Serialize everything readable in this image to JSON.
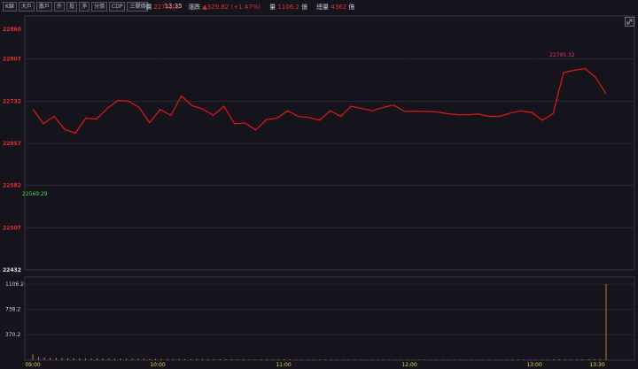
{
  "toolbar": {
    "buttons": [
      "K線",
      "大戶",
      "散戶",
      "外",
      "投",
      "淨",
      "分價",
      "CDP",
      "三關價"
    ],
    "time": "13:35"
  },
  "quote": {
    "price_label": "價",
    "price": "22761.6",
    "change_label": "漲跌",
    "change": "▲329.82 (+1.47%)",
    "volume_label": "量",
    "volume": "1106.2",
    "volume_unit": "億",
    "total_label": "總量",
    "total": "4362",
    "total_unit": "億"
  },
  "colors": {
    "price_line": "#e01818",
    "volume_bar": "#d9863a",
    "grid": "#34323f",
    "axis_label": "#e03030",
    "time_label": "#e6d24a",
    "ref_label": "#4fd24f",
    "max_label": "#e0306a"
  },
  "chart_data": [
    {
      "type": "line",
      "title": "",
      "ylim": [
        22432,
        22860
      ],
      "y_ticks": [
        22860,
        22807,
        22732,
        22657,
        22582,
        22507,
        22432
      ],
      "x_ticks": [
        "09:00",
        "10:00",
        "11:00",
        "12:00",
        "13:00",
        "13:30"
      ],
      "reference_label": "22569.29",
      "max_label": "22795.32",
      "x": [
        "09:00",
        "09:05",
        "09:10",
        "09:15",
        "09:20",
        "09:25",
        "09:30",
        "09:35",
        "09:40",
        "09:45",
        "09:50",
        "09:55",
        "10:00",
        "10:05",
        "10:10",
        "10:15",
        "10:20",
        "10:25",
        "10:30",
        "10:35",
        "10:40",
        "10:45",
        "10:50",
        "10:55",
        "11:00",
        "11:05",
        "11:10",
        "11:15",
        "11:20",
        "11:25",
        "11:30",
        "11:35",
        "11:40",
        "11:45",
        "11:50",
        "11:55",
        "12:00",
        "12:05",
        "12:10",
        "12:15",
        "12:20",
        "12:25",
        "12:30",
        "12:35",
        "12:40",
        "12:45",
        "12:50",
        "12:55",
        "13:00",
        "13:05",
        "13:10",
        "13:15",
        "13:20",
        "13:25",
        "13:30"
      ],
      "values": [
        22718,
        22695,
        22702,
        22685,
        22672,
        22705,
        22697,
        22722,
        22730,
        22735,
        22718,
        22697,
        22714,
        22710,
        22738,
        22727,
        22715,
        22710,
        22720,
        22695,
        22690,
        22684,
        22696,
        22705,
        22712,
        22708,
        22700,
        22701,
        22712,
        22708,
        22720,
        22722,
        22712,
        22724,
        22722,
        22717,
        22711,
        22717,
        22710,
        22713,
        22705,
        22711,
        22706,
        22708,
        22702,
        22714,
        22712,
        22715,
        22695,
        22713,
        22780,
        22790,
        22787,
        22778,
        22745
      ]
    },
    {
      "type": "bar",
      "title": "",
      "ylim": [
        0,
        1106.2
      ],
      "y_ticks": [
        1106.2,
        738.2,
        370.2
      ],
      "values": [
        85,
        48,
        40,
        36,
        34,
        32,
        30,
        28,
        27,
        26,
        25,
        24,
        23,
        22,
        22,
        21,
        20,
        20,
        19,
        19,
        18,
        18,
        17,
        17,
        16,
        16,
        16,
        15,
        15,
        15,
        14,
        14,
        14,
        13,
        13,
        13,
        12,
        12,
        12,
        12,
        11,
        11,
        11,
        11,
        11,
        10,
        10,
        10,
        10,
        10,
        9,
        9,
        9,
        9,
        9,
        9,
        8,
        8,
        8,
        8,
        8,
        8,
        8,
        8,
        8,
        8,
        8,
        8,
        8,
        8,
        8,
        8,
        8,
        8,
        8,
        8,
        8,
        8,
        8,
        8,
        8,
        9,
        9,
        9,
        9,
        9,
        10,
        10,
        10,
        10,
        10,
        11,
        11,
        12,
        12,
        13,
        14,
        15,
        1106.2
      ]
    }
  ]
}
